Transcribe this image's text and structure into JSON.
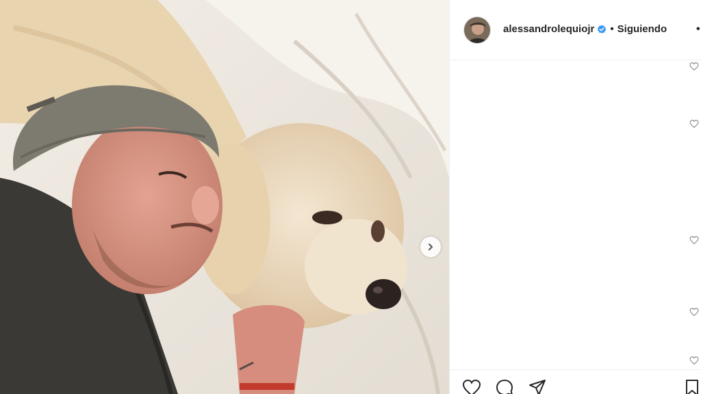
{
  "post": {
    "photo": {
      "alt_subject": "man-with-beanie-and-golden-retriever-photo",
      "next_icon": "chevron-right-icon"
    },
    "header": {
      "username": "alessandrolequiojr",
      "verified_icon": "verified-badge-icon",
      "separator": "•",
      "follow_state": "Siguiendo",
      "more_icon": "more-options-icon",
      "more_glyph": "•"
    },
    "comments": {
      "like_icon": "heart-outline-icon",
      "count_visible_likes": 5
    },
    "actions": {
      "like_icon": "heart-outline-icon",
      "comment_icon": "comment-bubble-icon",
      "share_icon": "paper-plane-icon",
      "save_icon": "bookmark-icon"
    },
    "colors": {
      "text": "#262626",
      "border": "#efefef",
      "verified_blue": "#3897f0",
      "icon": "#262626"
    }
  }
}
